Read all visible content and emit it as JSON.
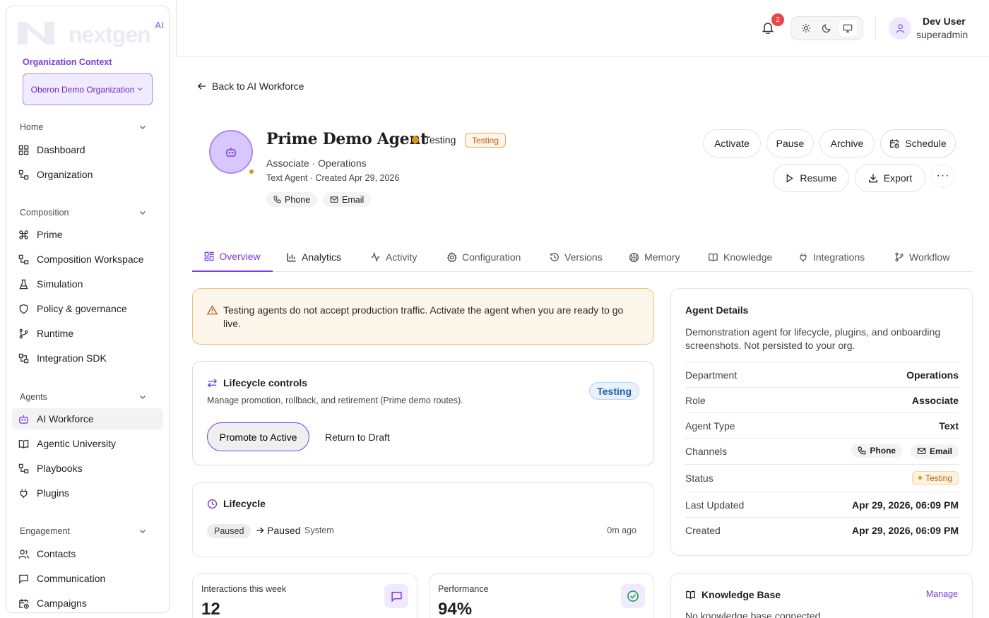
{
  "brand": {
    "logo_text": "nextgen",
    "logo_ai": "AI"
  },
  "org": {
    "label": "Organization Context",
    "selected": "Oberon Demo Organization"
  },
  "sidebar": {
    "sections": [
      {
        "title": "Home",
        "items": [
          "Dashboard",
          "Organization"
        ]
      },
      {
        "title": "Composition",
        "items": [
          "Prime",
          "Composition Workspace",
          "Simulation",
          "Policy & governance",
          "Runtime",
          "Integration SDK"
        ]
      },
      {
        "title": "Agents",
        "items": [
          "AI Workforce",
          "Agentic University",
          "Playbooks",
          "Plugins"
        ]
      },
      {
        "title": "Engagement",
        "items": [
          "Contacts",
          "Communication",
          "Campaigns"
        ]
      }
    ]
  },
  "topbar": {
    "notification_count": "2",
    "user_name": "Dev User",
    "user_role": "superadmin"
  },
  "page": {
    "back_label": "Back to AI Workforce",
    "agent_name": "Prime Demo Agent",
    "status_text": "Testing",
    "status_pill": "Testing",
    "subtitle": "Associate · Operations",
    "meta": "Text Agent · Created Apr 29, 2026",
    "channels": [
      "Phone",
      "Email"
    ],
    "actions": {
      "activate": "Activate",
      "pause": "Pause",
      "archive": "Archive",
      "schedule": "Schedule",
      "resume": "Resume",
      "export": "Export",
      "more": "···"
    }
  },
  "tabs": [
    "Overview",
    "Analytics",
    "Activity",
    "Configuration",
    "Versions",
    "Memory",
    "Knowledge",
    "Integrations",
    "Workflow"
  ],
  "alert": "Testing agents do not accept production traffic. Activate the agent when you are ready to go live.",
  "lifecycle_controls": {
    "title": "Lifecycle controls",
    "desc": "Manage promotion, rollback, and retirement (Prime demo routes).",
    "status": "Testing",
    "promote": "Promote to Active",
    "draft": "Return to Draft"
  },
  "lifecycle": {
    "title": "Lifecycle",
    "from": "Paused",
    "to": "Paused",
    "actor": "System",
    "ago": "0m ago"
  },
  "stats": [
    {
      "label": "Interactions this week",
      "value": "12",
      "color": "#7c3aed"
    },
    {
      "label": "Performance",
      "value": "94%",
      "color": "#16a34a"
    }
  ],
  "details": {
    "title": "Agent Details",
    "desc": "Demonstration agent for lifecycle, plugins, and onboarding screenshots. Not persisted to your org.",
    "rows": {
      "department": [
        "Department",
        "Operations"
      ],
      "role": [
        "Role",
        "Associate"
      ],
      "type": [
        "Agent Type",
        "Text"
      ],
      "channels": [
        "Channels",
        ""
      ],
      "status": [
        "Status",
        "Testing"
      ],
      "updated": [
        "Last Updated",
        "Apr 29, 2026, 06:09 PM"
      ],
      "created": [
        "Created",
        "Apr 29, 2026, 06:09 PM"
      ]
    }
  },
  "knowledge": {
    "title": "Knowledge Base",
    "manage": "Manage",
    "empty": "No knowledge base connected"
  }
}
